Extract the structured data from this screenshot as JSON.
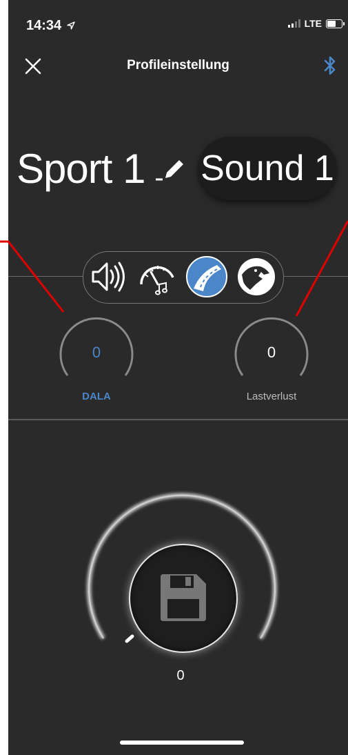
{
  "status": {
    "time": "14:34",
    "network": "LTE"
  },
  "header": {
    "title": "Profileinstellung"
  },
  "profile": {
    "name": "Sport 1",
    "sound": "Sound 1"
  },
  "modes": [
    {
      "name": "speaker",
      "active": false
    },
    {
      "name": "gauge-music",
      "active": false
    },
    {
      "name": "road",
      "active": true
    },
    {
      "name": "panther",
      "active": false
    }
  ],
  "knobs": {
    "left": {
      "value": "0",
      "label": "DALA"
    },
    "right": {
      "value": "0",
      "label": "Lastverlust"
    }
  },
  "main_dial": {
    "value": "0"
  },
  "colors": {
    "accent": "#4a86c8",
    "background": "#2a2a2a",
    "annotation": "#e00000"
  }
}
